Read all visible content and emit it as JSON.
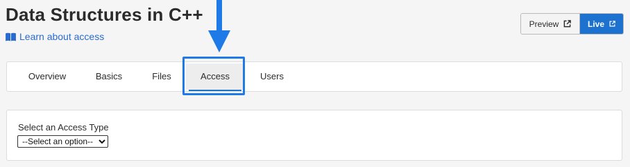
{
  "header": {
    "title": "Data Structures in C++",
    "learn_link": "Learn about access"
  },
  "actions": {
    "preview_label": "Preview",
    "live_label": "Live"
  },
  "tabs": [
    {
      "label": "Overview"
    },
    {
      "label": "Basics"
    },
    {
      "label": "Files"
    },
    {
      "label": "Access",
      "active": true
    },
    {
      "label": "Users"
    }
  ],
  "access_panel": {
    "label": "Select an Access Type",
    "select_value": "--Select an option--"
  },
  "colors": {
    "accent": "#1d72d0",
    "highlight": "#1e7ae6"
  },
  "icons": {
    "learn": "book-icon",
    "external": "external-link-icon",
    "annotation": "arrow-down-icon"
  }
}
